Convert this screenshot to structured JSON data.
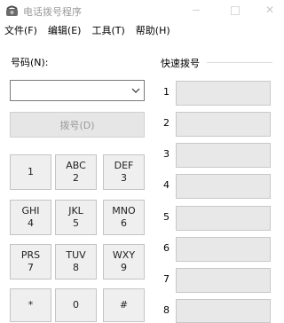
{
  "window": {
    "title": "电话拨号程序",
    "minimize": "—",
    "maximize": "",
    "close": "✕"
  },
  "menu": [
    "文件(F)",
    "编辑(E)",
    "工具(T)",
    "帮助(H)"
  ],
  "phone": {
    "label": "号码(N):",
    "value": ""
  },
  "dial_button": "拨号(D)",
  "keypad": [
    {
      "letters": "",
      "digit": "1"
    },
    {
      "letters": "ABC",
      "digit": "2"
    },
    {
      "letters": "DEF",
      "digit": "3"
    },
    {
      "letters": "GHI",
      "digit": "4"
    },
    {
      "letters": "JKL",
      "digit": "5"
    },
    {
      "letters": "MNO",
      "digit": "6"
    },
    {
      "letters": "PRS",
      "digit": "7"
    },
    {
      "letters": "TUV",
      "digit": "8"
    },
    {
      "letters": "WXY",
      "digit": "9"
    },
    {
      "letters": "",
      "digit": "*"
    },
    {
      "letters": "",
      "digit": "0"
    },
    {
      "letters": "",
      "digit": "#"
    }
  ],
  "speed_dial": {
    "label": "快速拨号",
    "numbers": [
      "1",
      "2",
      "3",
      "4",
      "5",
      "6",
      "7",
      "8"
    ]
  }
}
